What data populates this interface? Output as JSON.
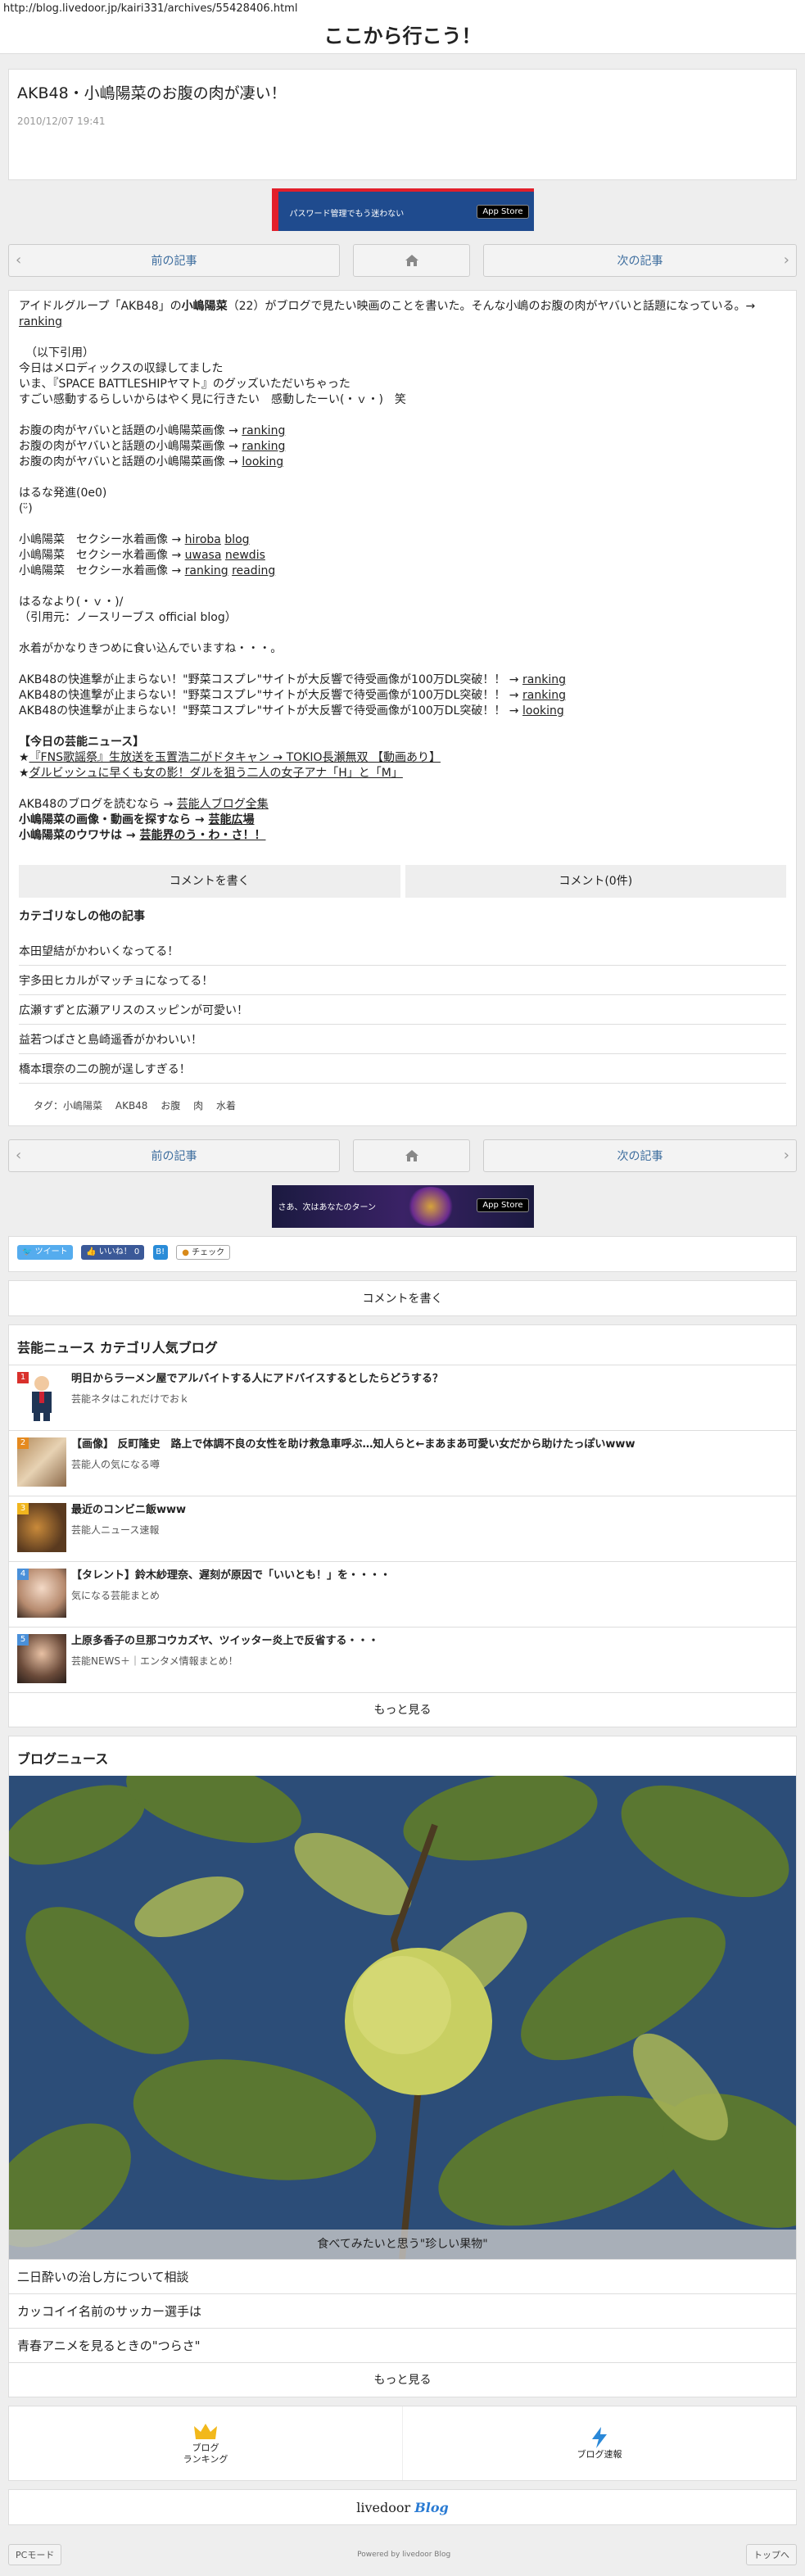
{
  "url": "http://blog.livedoor.jp/kairi331/archives/55428406.html",
  "site_title": "ここから行こう！",
  "article": {
    "title": "AKB48・小嶋陽菜のお腹の肉が凄い！",
    "date": "2010/12/07 19:41"
  },
  "banner1": {
    "text": "パスワード管理でもう迷わない",
    "store": "App Store"
  },
  "banner2": {
    "text": "さあ、次はあなたのターン",
    "store": "App Store"
  },
  "pager": {
    "prev": "前の記事",
    "next": "次の記事"
  },
  "body": {
    "intro_a": "アイドルグループ「AKB48」の",
    "intro_bold": "小嶋陽菜",
    "intro_b": "（22）がブログで見たい映画のことを書いた。そんな小嶋のお腹の肉がヤバいと話題になっている。→",
    "intro_link": "ranking",
    "quote_lines": [
      "（以下引用）",
      "今日はメロディックスの収録してました",
      "いま、『SPACE BATTLESHIPヤマト』のグッズいただいちゃった",
      "すごい感動するらしいからはやく見に行きたい　感動したーい(・ｖ・)　笑"
    ],
    "belly_lines": [
      {
        "text": "お腹の肉がヤバいと話題の小嶋陽菜画像 → ",
        "link": "ranking"
      },
      {
        "text": "お腹の肉がヤバいと話題の小嶋陽菜画像 → ",
        "link": "ranking"
      },
      {
        "text": "お腹の肉がヤバいと話題の小嶋陽菜画像 → ",
        "link": "looking"
      }
    ],
    "haruna_lines": [
      "はるな発進(0e0)",
      "(ᵕ̈)"
    ],
    "sexy_lines": [
      {
        "text": "小嶋陽菜　セクシー水着画像 → ",
        "link1": "hiroba",
        "link2": "blog"
      },
      {
        "text": "小嶋陽菜　セクシー水着画像 → ",
        "link1": "uwasa",
        "link2": "newdis"
      },
      {
        "text": "小嶋陽菜　セクシー水着画像 → ",
        "link1": "ranking",
        "link2": "reading"
      }
    ],
    "source_lines": [
      "はるなより(・ｖ・)/",
      "（引用元：ノースリーブス official blog）"
    ],
    "comment_line": "水着がかなりきつめに食い込んでいますね・・・。",
    "akb_lines": [
      {
        "text": "AKB48の快進撃が止まらない！\"野菜コスプレ\"サイトが大反響で待受画像が100万DL突破！！ → ",
        "link": "ranking"
      },
      {
        "text": "AKB48の快進撃が止まらない！\"野菜コスプレ\"サイトが大反響で待受画像が100万DL突破！！ → ",
        "link": "ranking"
      },
      {
        "text": "AKB48の快進撃が止まらない！\"野菜コスプレ\"サイトが大反響で待受画像が100万DL突破！！ → ",
        "link": "looking"
      }
    ],
    "today_title": "【今日の芸能ニュース】",
    "today_lines": [
      {
        "prefix": "★",
        "link": "『FNS歌謡祭』生放送を玉置浩二がドタキャン → TOKIO長瀬無双 【動画あり】"
      },
      {
        "prefix": "★",
        "link": "ダルビッシュに早くも女の影！ダルを狙う二人の女子アナ「H」と「M」"
      }
    ],
    "end_lines": [
      {
        "text": "AKB48のブログを読むなら → ",
        "link": "芸能人ブログ全集",
        "bold": false
      },
      {
        "text": "小嶋陽菜の画像・動画を探すなら → ",
        "link": "芸能広場",
        "bold": true
      },
      {
        "text": "小嶋陽菜のウワサは → ",
        "link": "芸能界のう・わ・さ！！",
        "bold": true
      }
    ]
  },
  "comment_buttons": {
    "write": "コメントを書く",
    "count": "コメント(0件)"
  },
  "category": {
    "title": "カテゴリなしの他の記事",
    "items": [
      "本田望結がかわいくなってる！",
      "宇多田ヒカルがマッチョになってる！",
      "広瀬すずと広瀬アリスのスッピンが可愛い！",
      "益若つばさと島崎遥香がかわいい！",
      "橋本環奈の二の腕が逞しすぎる！"
    ]
  },
  "tags": {
    "label": "タグ：",
    "items": [
      "小嶋陽菜",
      "AKB48",
      "お腹",
      "肉",
      "水着"
    ]
  },
  "social": {
    "tweet": "ツイート",
    "like": "いいね！ 0",
    "hatena": "B!",
    "check": "チェック"
  },
  "write_comment": "コメントを書く",
  "popular": {
    "title": "芸能ニュース カテゴリ人気ブログ",
    "items": [
      {
        "rank": "1",
        "title": "明日からラーメン屋でアルバイトする人にアドバイスするとしたらどうする？",
        "source": "芸能ネタはこれだけでおｋ",
        "color": "#d9302b"
      },
      {
        "rank": "2",
        "title": "【画像】 反町隆史　路上で体調不良の女性を助け救急車呼ぶ…知人らと←まあまあ可愛い女だから助けたっぽいwww",
        "source": "芸能人の気になる噂",
        "color": "#e58a1f"
      },
      {
        "rank": "3",
        "title": "最近のコンビニ飯www",
        "source": "芸能人ニュース速報",
        "color": "#f0b51e"
      },
      {
        "rank": "4",
        "title": "【タレント】鈴木紗理奈、遅刻が原因で「いいとも！」を・・・・",
        "source": "気になる芸能まとめ",
        "color": "#4a90d9"
      },
      {
        "rank": "5",
        "title": "上原多香子の旦那コウカズヤ、ツイッター炎上で反省する・・・",
        "source": "芸能NEWS＋｜エンタメ情報まとめ！",
        "color": "#4a90d9"
      }
    ],
    "more": "もっと見る"
  },
  "blog_news": {
    "title": "ブログニュース",
    "caption": "食べてみたいと思う\"珍しい果物\"",
    "items": [
      "二日酔いの治し方について相談",
      "カッコイイ名前のサッカー選手は",
      "青春アニメを見るときの\"つらさ\""
    ],
    "more": "もっと見る"
  },
  "footer_nav": {
    "ranking": "ブログ\nランキング",
    "speed": "ブログ速報"
  },
  "logo": {
    "text": "livedoor",
    "blog": "Blog"
  },
  "footer": {
    "pc": "PCモード",
    "powered": "Powered by livedoor Blog",
    "top": "トップへ"
  }
}
